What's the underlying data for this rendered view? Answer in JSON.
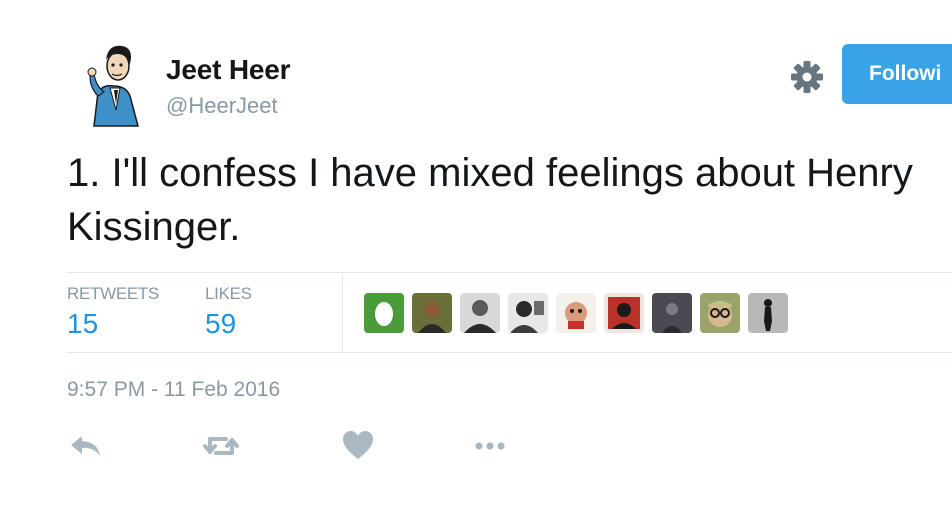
{
  "user": {
    "display_name": "Jeet Heer",
    "handle": "@HeerJeet",
    "follow_label": "Followi"
  },
  "tweet": {
    "text": "1. I'll confess I have mixed feelings about Henry Kissinger."
  },
  "stats": {
    "retweets_label": "RETWEETS",
    "retweets_value": "15",
    "likes_label": "LIKES",
    "likes_value": "59"
  },
  "likers": [
    {
      "icon": "default-egg-avatar",
      "color": "#4a9b3a"
    },
    {
      "icon": "person-avatar",
      "color": "#6a6f3a"
    },
    {
      "icon": "person-avatar",
      "color": "#8b8b8b"
    },
    {
      "icon": "person-avatar",
      "color": "#3c3c3c"
    },
    {
      "icon": "person-avatar",
      "color": "#c88a6a"
    },
    {
      "icon": "person-avatar",
      "color": "#b8322a"
    },
    {
      "icon": "person-avatar",
      "color": "#4a4a52"
    },
    {
      "icon": "person-avatar",
      "color": "#9aa36a"
    },
    {
      "icon": "person-avatar",
      "color": "#7a7a7a"
    }
  ],
  "timestamp": "9:57 PM - 11 Feb 2016",
  "icons": {
    "gear": "gear-icon",
    "reply": "reply-icon",
    "retweet": "retweet-icon",
    "like": "heart-icon",
    "more": "more-icon"
  },
  "colors": {
    "accent": "#1b95e0",
    "follow_button": "#3aa3e8",
    "muted": "#8899a6",
    "action_icon": "#aab8c2"
  }
}
